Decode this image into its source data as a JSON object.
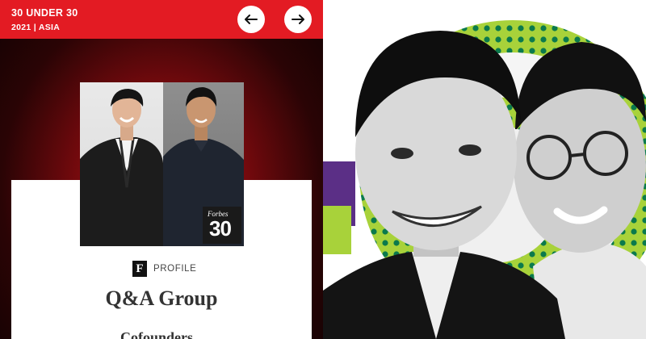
{
  "header": {
    "title": "30 UNDER 30",
    "subtitle": "2021 | ASIA",
    "prev_icon": "arrow-left-icon",
    "next_icon": "arrow-right-icon"
  },
  "badge": {
    "brand": "Forbes",
    "number": "30"
  },
  "profile": {
    "logo_letter": "F",
    "label": "PROFILE",
    "company": "Q&A Group",
    "role": "Cofounders"
  },
  "colors": {
    "brand_red": "#e31b23",
    "halo_green": "#9fcf2f",
    "dot_green": "#0a7a4a"
  }
}
